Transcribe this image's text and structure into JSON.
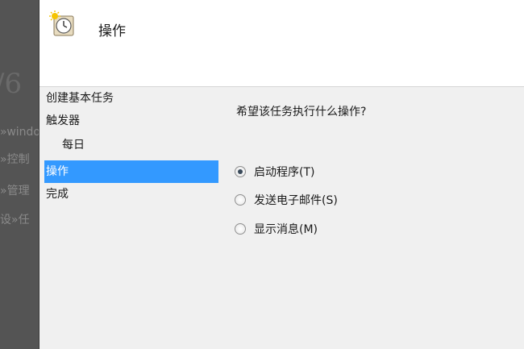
{
  "background": {
    "big_text": "/6",
    "lines": [
      "»windo",
      "»控制",
      "»管理",
      "设»任"
    ]
  },
  "window": {
    "title": "操作",
    "icon": "scheduled-task-clock-icon"
  },
  "steps": [
    {
      "label": "创建基本任务",
      "active": false
    },
    {
      "label": "触发器",
      "active": false
    },
    {
      "label": "每日",
      "active": false
    },
    {
      "label": "操作",
      "active": true
    },
    {
      "label": "完成",
      "active": false
    }
  ],
  "content": {
    "question": "希望该任务执行什么操作?",
    "options": [
      {
        "label": "启动程序(T)",
        "checked": true
      },
      {
        "label": "发送电子邮件(S)",
        "checked": false
      },
      {
        "label": "显示消息(M)",
        "checked": false
      }
    ]
  },
  "colors": {
    "selection": "#3399ff",
    "window_bg": "#f0f0f0",
    "header_bg": "#ffffff"
  }
}
